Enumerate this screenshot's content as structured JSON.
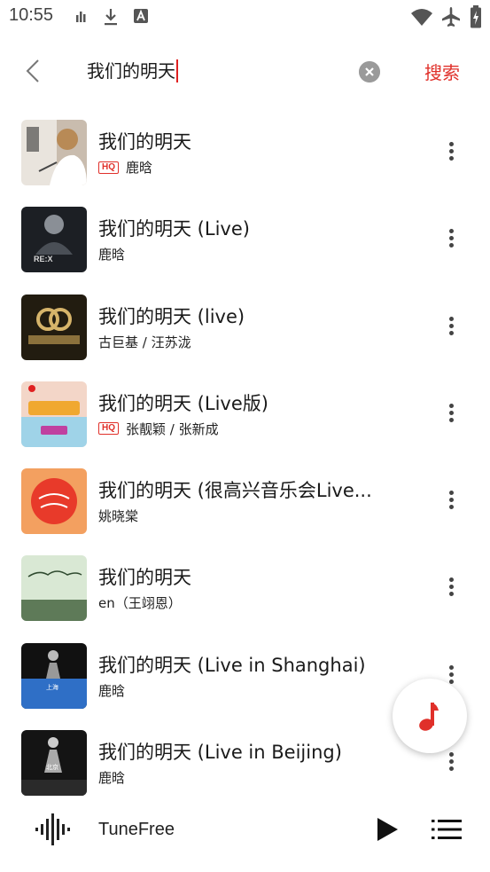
{
  "status": {
    "time": "10:55"
  },
  "search": {
    "query": "我们的明天",
    "button_label": "搜索"
  },
  "songs": [
    {
      "title": "我们的明天",
      "hq": "HQ",
      "artist": "鹿晗",
      "cover": "cover-portrait-light"
    },
    {
      "title": "我们的明天 (Live)",
      "hq": "",
      "artist": "鹿晗",
      "cover": "cover-concert-dark"
    },
    {
      "title": "我们的明天 (live)",
      "hq": "",
      "artist": "古巨基 / 汪苏泷",
      "cover": "cover-show-gold"
    },
    {
      "title": "我们的明天 (Live版)",
      "hq": "HQ",
      "artist": "张靓颖 / 张新成",
      "cover": "cover-show-colorful"
    },
    {
      "title": "我们的明天 (很高兴音乐会Live...",
      "hq": "",
      "artist": "姚晓棠",
      "cover": "cover-orange"
    },
    {
      "title": "我们的明天",
      "hq": "",
      "artist": "en（王翊恩）",
      "cover": "cover-green"
    },
    {
      "title": "我们的明天 (Live in Shanghai)",
      "hq": "",
      "artist": "鹿晗",
      "cover": "cover-shanghai"
    },
    {
      "title": "我们的明天 (Live in Beijing)",
      "hq": "",
      "artist": "鹿晗",
      "cover": "cover-beijing"
    }
  ],
  "player": {
    "title": "TuneFree"
  },
  "colors": {
    "accent": "#e0302a"
  }
}
